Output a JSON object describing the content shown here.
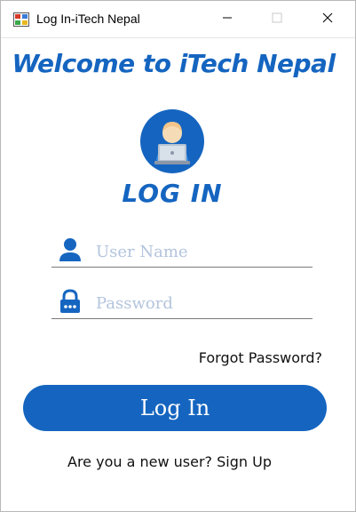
{
  "window": {
    "title": "Log In-iTech Nepal",
    "controls": {
      "minimize": "minimize-icon",
      "maximize": "maximize-icon",
      "close": "close-icon"
    }
  },
  "header": {
    "welcome": "Welcome to iTech Nepal",
    "heading": "LOG IN",
    "avatar_icon": "user-at-laptop-icon"
  },
  "form": {
    "username": {
      "placeholder": "User Name",
      "value": "",
      "icon": "user-icon"
    },
    "password": {
      "placeholder": "Password",
      "value": "",
      "icon": "lock-icon"
    },
    "forgot_label": "Forgot Password?",
    "login_label": "Log In"
  },
  "footer": {
    "question": "Are you a new user?",
    "signup_label": "Sign Up"
  },
  "colors": {
    "accent": "#1565c0",
    "placeholder": "#b3c4dd",
    "text": "#111111"
  }
}
